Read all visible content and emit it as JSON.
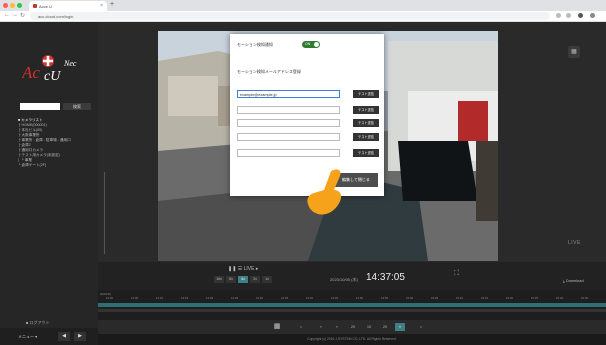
{
  "browser": {
    "tab_title": "Acce U",
    "url": "acc-cloud.com/login"
  },
  "sidebar": {
    "search_button": "検索",
    "tree": [
      "■ カメラリスト",
      "  ├ HOME(000001)",
      "  ├ 本社ビル(00)",
      "  ├ 大阪事業所",
      "  ├ 事業所 - 倉庫 - 駐車場 - 通用口",
      "  ├ 倉庫2",
      "  ├ 通用口カメラ",
      "  ├ テスト用カメラ(未設定)",
      "  │  └ 事業",
      "  └ 倉庫ゲート(2F)"
    ],
    "logout": "■ ログアウト",
    "menu_label": "メニュー ▾"
  },
  "modal": {
    "toggle_label": "モーション検知通知",
    "toggle_state": "ON",
    "section_label": "モーション検知メールアドレス登録",
    "emails": [
      {
        "value": "example@example.jp",
        "placeholder": ""
      },
      {
        "value": "",
        "placeholder": ""
      },
      {
        "value": "",
        "placeholder": ""
      },
      {
        "value": "",
        "placeholder": ""
      },
      {
        "value": "",
        "placeholder": ""
      }
    ],
    "test_button": "テスト送信",
    "save_button": "編集して閉じる"
  },
  "video": {
    "live_label": "LIVE",
    "grid_icon": "grid-icon"
  },
  "controls": {
    "play_label": "❚❚ ☰ LIVE ▸",
    "speeds": [
      "16x",
      "8x",
      "4x",
      "2x",
      "1x"
    ],
    "active_speed": "4x",
    "date_label": "2023/10/05 (木)",
    "time": "14:37:05",
    "download": "⤓ Download"
  },
  "timeline": {
    "label": "2023/10",
    "ticks": [
      "14:00",
      "14:05",
      "14:10",
      "14:15",
      "14:20",
      "14:25",
      "14:30",
      "14:35",
      "14:40",
      "14:45",
      "14:50",
      "14:55",
      "15:00",
      "15:05",
      "15:10",
      "15:15",
      "15:20",
      "15:25",
      "15:30",
      "15:35"
    ]
  },
  "pager": {
    "pages": [
      "<",
      "«",
      "«",
      "20",
      "10",
      "20",
      "»",
      ">"
    ],
    "active_index": 6
  },
  "footer": {
    "copyright": "Copyright (c) 2016 J-SYSTEM CO.,LTD. All Rights Reserved."
  },
  "colors": {
    "accent_teal": "#3f7f86",
    "toggle_green": "#2e7d32",
    "logo_red": "#d0312d"
  }
}
